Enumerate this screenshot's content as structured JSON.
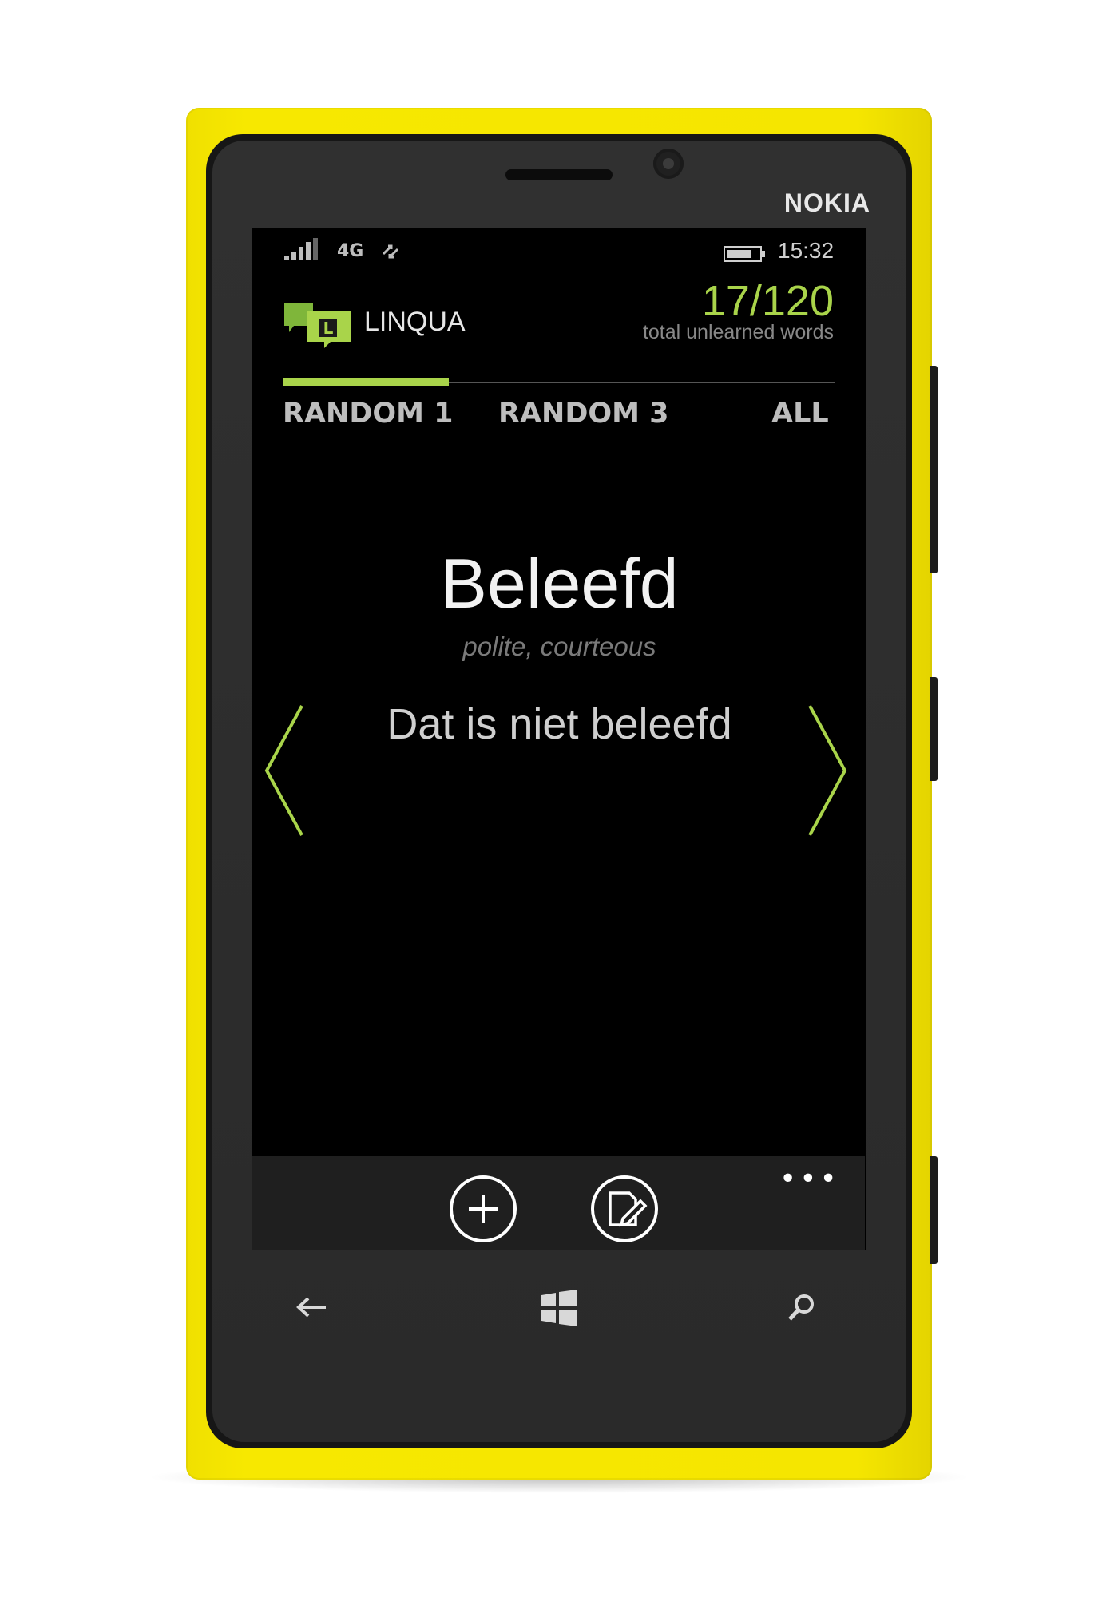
{
  "device": {
    "brand": "NOKIA"
  },
  "status_bar": {
    "network": "4G",
    "time": "15:32"
  },
  "header": {
    "app_name": "LINQUA",
    "counter": "17/120",
    "counter_label": "total unlearned words"
  },
  "tabs": [
    {
      "label": "RANDOM 1",
      "active": true
    },
    {
      "label": "RANDOM 3",
      "active": false
    },
    {
      "label": "ALL",
      "active": false
    }
  ],
  "card": {
    "word": "Beleefd",
    "translation": "polite, courteous",
    "example": "Dat is niet beleefd"
  },
  "app_bar": {
    "more_label": "•••",
    "buttons": [
      "add-icon",
      "edit-icon"
    ]
  },
  "nav_bar": {
    "icons": [
      "back-arrow-icon",
      "windows-start-icon",
      "search-icon"
    ]
  },
  "colors": {
    "accent": "#a9d44a",
    "phone_body": "#f5e600",
    "screen_bg": "#000000"
  }
}
